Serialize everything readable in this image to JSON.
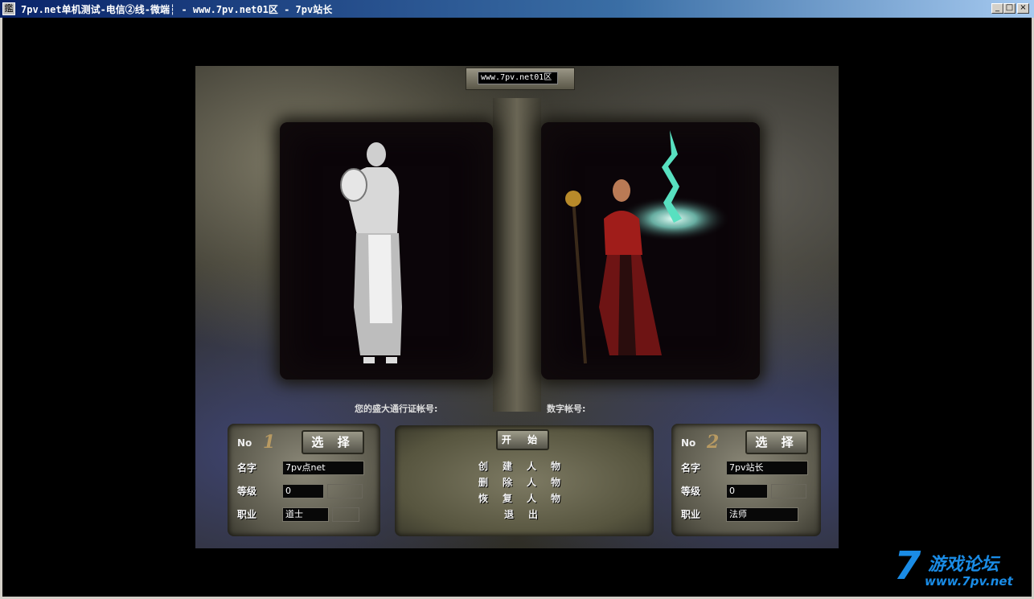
{
  "window": {
    "title": "7pv.net单机测试-电信②线-微端┆ - www.7pv.net01区 - 7pv站长",
    "app_icon_glyph": "鑑"
  },
  "server": {
    "name": "www.7pv.net01区"
  },
  "account": {
    "passport_label": "您的盛大通行证帐号:",
    "digital_label": "数字帐号:"
  },
  "slots": [
    {
      "no_label": "No",
      "no": "1",
      "select_label": "选 择",
      "name_label": "名字",
      "name": "7pv点net",
      "level_label": "等级",
      "level": "0",
      "job_label": "职业",
      "job": "道士"
    },
    {
      "no_label": "No",
      "no": "2",
      "select_label": "选 择",
      "name_label": "名字",
      "name": "7pv站长",
      "level_label": "等级",
      "level": "0",
      "job_label": "职业",
      "job": "法师"
    }
  ],
  "menu": {
    "start": "开 始",
    "create": "创建人物",
    "delete": "删除人物",
    "restore": "恢复人物",
    "exit": "退出"
  },
  "watermark": {
    "seven": "7",
    "title": "游戏论坛",
    "url": "www.7pv.net"
  },
  "colors": {
    "title_bar": "#0a246a",
    "watermark": "#1a8ce6",
    "slot_number": "#b89a62"
  }
}
